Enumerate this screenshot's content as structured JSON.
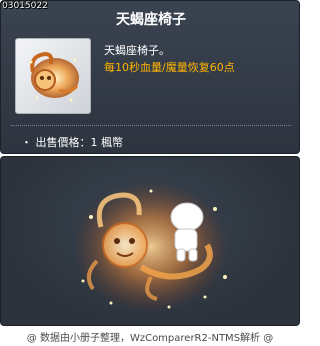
{
  "item": {
    "id": "03015022",
    "name": "天蝎座椅子",
    "description_line1": "天蝎座椅子。",
    "description_line2": "每10秒血量/魔量恢复60点",
    "price": "・ 出售價格：1 楓幣"
  },
  "icons": {
    "item_icon": "scorpion-chair-icon",
    "preview": "scorpion-chair-preview"
  },
  "colors": {
    "panel": "#343c47",
    "highlight_text": "#ffb400",
    "glow": "#ffb060"
  },
  "footer": "@ 数据由小册子整理，WzComparerR2-NTMS解析 @"
}
